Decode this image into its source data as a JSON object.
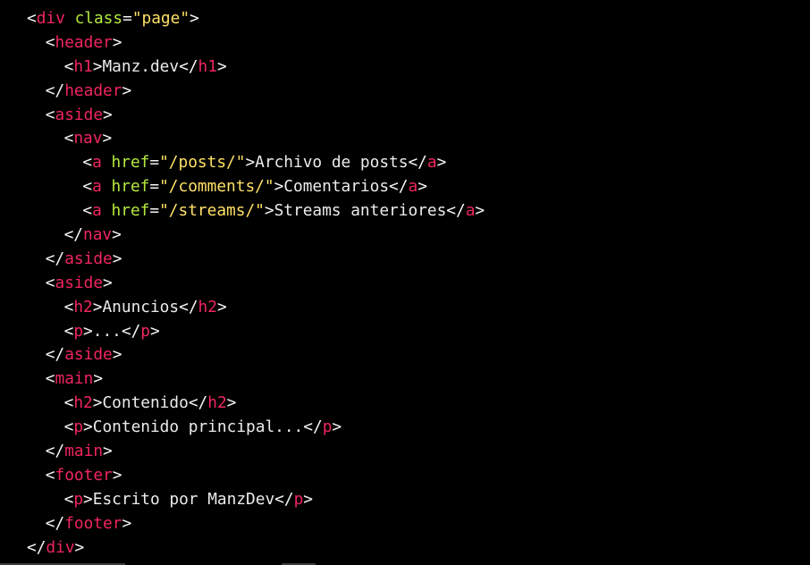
{
  "editor": {
    "lines": [
      {
        "indent": 0,
        "tokens": [
          {
            "t": "punct",
            "v": "<"
          },
          {
            "t": "tag",
            "v": "div"
          },
          {
            "t": "txt",
            "v": " "
          },
          {
            "t": "attr",
            "v": "class"
          },
          {
            "t": "punct",
            "v": "="
          },
          {
            "t": "str",
            "v": "\"page\""
          },
          {
            "t": "punct",
            "v": ">"
          }
        ]
      },
      {
        "indent": 1,
        "tokens": [
          {
            "t": "punct",
            "v": "<"
          },
          {
            "t": "tag",
            "v": "header"
          },
          {
            "t": "punct",
            "v": ">"
          }
        ]
      },
      {
        "indent": 2,
        "tokens": [
          {
            "t": "punct",
            "v": "<"
          },
          {
            "t": "tag",
            "v": "h1"
          },
          {
            "t": "punct",
            "v": ">"
          },
          {
            "t": "txt",
            "v": "Manz.dev"
          },
          {
            "t": "punct",
            "v": "</"
          },
          {
            "t": "tag",
            "v": "h1"
          },
          {
            "t": "punct",
            "v": ">"
          }
        ]
      },
      {
        "indent": 1,
        "tokens": [
          {
            "t": "punct",
            "v": "</"
          },
          {
            "t": "tag",
            "v": "header"
          },
          {
            "t": "punct",
            "v": ">"
          }
        ]
      },
      {
        "indent": 1,
        "tokens": [
          {
            "t": "punct",
            "v": "<"
          },
          {
            "t": "tag",
            "v": "aside"
          },
          {
            "t": "punct",
            "v": ">"
          }
        ]
      },
      {
        "indent": 2,
        "tokens": [
          {
            "t": "punct",
            "v": "<"
          },
          {
            "t": "tag",
            "v": "nav"
          },
          {
            "t": "punct",
            "v": ">"
          }
        ]
      },
      {
        "indent": 3,
        "tokens": [
          {
            "t": "punct",
            "v": "<"
          },
          {
            "t": "tag",
            "v": "a"
          },
          {
            "t": "txt",
            "v": " "
          },
          {
            "t": "attr",
            "v": "href"
          },
          {
            "t": "punct",
            "v": "="
          },
          {
            "t": "str",
            "v": "\"/posts/\""
          },
          {
            "t": "punct",
            "v": ">"
          },
          {
            "t": "txt",
            "v": "Archivo de posts"
          },
          {
            "t": "punct",
            "v": "</"
          },
          {
            "t": "tag",
            "v": "a"
          },
          {
            "t": "punct",
            "v": ">"
          }
        ]
      },
      {
        "indent": 3,
        "tokens": [
          {
            "t": "punct",
            "v": "<"
          },
          {
            "t": "tag",
            "v": "a"
          },
          {
            "t": "txt",
            "v": " "
          },
          {
            "t": "attr",
            "v": "href"
          },
          {
            "t": "punct",
            "v": "="
          },
          {
            "t": "str",
            "v": "\"/comments/\""
          },
          {
            "t": "punct",
            "v": ">"
          },
          {
            "t": "txt",
            "v": "Comentarios"
          },
          {
            "t": "punct",
            "v": "</"
          },
          {
            "t": "tag",
            "v": "a"
          },
          {
            "t": "punct",
            "v": ">"
          }
        ]
      },
      {
        "indent": 3,
        "tokens": [
          {
            "t": "punct",
            "v": "<"
          },
          {
            "t": "tag",
            "v": "a"
          },
          {
            "t": "txt",
            "v": " "
          },
          {
            "t": "attr",
            "v": "href"
          },
          {
            "t": "punct",
            "v": "="
          },
          {
            "t": "str",
            "v": "\"/streams/\""
          },
          {
            "t": "punct",
            "v": ">"
          },
          {
            "t": "txt",
            "v": "Streams anteriores"
          },
          {
            "t": "punct",
            "v": "</"
          },
          {
            "t": "tag",
            "v": "a"
          },
          {
            "t": "punct",
            "v": ">"
          }
        ]
      },
      {
        "indent": 2,
        "tokens": [
          {
            "t": "punct",
            "v": "</"
          },
          {
            "t": "tag",
            "v": "nav"
          },
          {
            "t": "punct",
            "v": ">"
          }
        ]
      },
      {
        "indent": 1,
        "tokens": [
          {
            "t": "punct",
            "v": "</"
          },
          {
            "t": "tag",
            "v": "aside"
          },
          {
            "t": "punct",
            "v": ">"
          }
        ]
      },
      {
        "indent": 1,
        "tokens": [
          {
            "t": "punct",
            "v": "<"
          },
          {
            "t": "tag",
            "v": "aside"
          },
          {
            "t": "punct",
            "v": ">"
          }
        ]
      },
      {
        "indent": 2,
        "tokens": [
          {
            "t": "punct",
            "v": "<"
          },
          {
            "t": "tag",
            "v": "h2"
          },
          {
            "t": "punct",
            "v": ">"
          },
          {
            "t": "txt",
            "v": "Anuncios"
          },
          {
            "t": "punct",
            "v": "</"
          },
          {
            "t": "tag",
            "v": "h2"
          },
          {
            "t": "punct",
            "v": ">"
          }
        ]
      },
      {
        "indent": 2,
        "tokens": [
          {
            "t": "punct",
            "v": "<"
          },
          {
            "t": "tag",
            "v": "p"
          },
          {
            "t": "punct",
            "v": ">"
          },
          {
            "t": "txt",
            "v": "..."
          },
          {
            "t": "punct",
            "v": "</"
          },
          {
            "t": "tag",
            "v": "p"
          },
          {
            "t": "punct",
            "v": ">"
          }
        ]
      },
      {
        "indent": 1,
        "tokens": [
          {
            "t": "punct",
            "v": "</"
          },
          {
            "t": "tag",
            "v": "aside"
          },
          {
            "t": "punct",
            "v": ">"
          }
        ]
      },
      {
        "indent": 1,
        "tokens": [
          {
            "t": "punct",
            "v": "<"
          },
          {
            "t": "tag",
            "v": "main"
          },
          {
            "t": "punct",
            "v": ">"
          }
        ]
      },
      {
        "indent": 2,
        "tokens": [
          {
            "t": "punct",
            "v": "<"
          },
          {
            "t": "tag",
            "v": "h2"
          },
          {
            "t": "punct",
            "v": ">"
          },
          {
            "t": "txt",
            "v": "Contenido"
          },
          {
            "t": "punct",
            "v": "</"
          },
          {
            "t": "tag",
            "v": "h2"
          },
          {
            "t": "punct",
            "v": ">"
          }
        ]
      },
      {
        "indent": 2,
        "tokens": [
          {
            "t": "punct",
            "v": "<"
          },
          {
            "t": "tag",
            "v": "p"
          },
          {
            "t": "punct",
            "v": ">"
          },
          {
            "t": "txt",
            "v": "Contenido principal..."
          },
          {
            "t": "punct",
            "v": "</"
          },
          {
            "t": "tag",
            "v": "p"
          },
          {
            "t": "punct",
            "v": ">"
          }
        ]
      },
      {
        "indent": 1,
        "tokens": [
          {
            "t": "punct",
            "v": "</"
          },
          {
            "t": "tag",
            "v": "main"
          },
          {
            "t": "punct",
            "v": ">"
          }
        ]
      },
      {
        "indent": 1,
        "tokens": [
          {
            "t": "punct",
            "v": "<"
          },
          {
            "t": "tag",
            "v": "footer"
          },
          {
            "t": "punct",
            "v": ">"
          }
        ]
      },
      {
        "indent": 2,
        "tokens": [
          {
            "t": "punct",
            "v": "<"
          },
          {
            "t": "tag",
            "v": "p"
          },
          {
            "t": "punct",
            "v": ">"
          },
          {
            "t": "txt",
            "v": "Escrito por ManzDev"
          },
          {
            "t": "punct",
            "v": "</"
          },
          {
            "t": "tag",
            "v": "p"
          },
          {
            "t": "punct",
            "v": ">"
          }
        ]
      },
      {
        "indent": 1,
        "tokens": [
          {
            "t": "punct",
            "v": "</"
          },
          {
            "t": "tag",
            "v": "footer"
          },
          {
            "t": "punct",
            "v": ">"
          }
        ]
      },
      {
        "indent": 0,
        "tokens": [
          {
            "t": "punct",
            "v": "</"
          },
          {
            "t": "tag",
            "v": "div"
          },
          {
            "t": "punct",
            "v": ">"
          }
        ]
      }
    ]
  },
  "colors": {
    "background": "#000000",
    "tag": "#f0255e",
    "attribute": "#b5ea3e",
    "string": "#ffe066",
    "text": "#ececec"
  }
}
